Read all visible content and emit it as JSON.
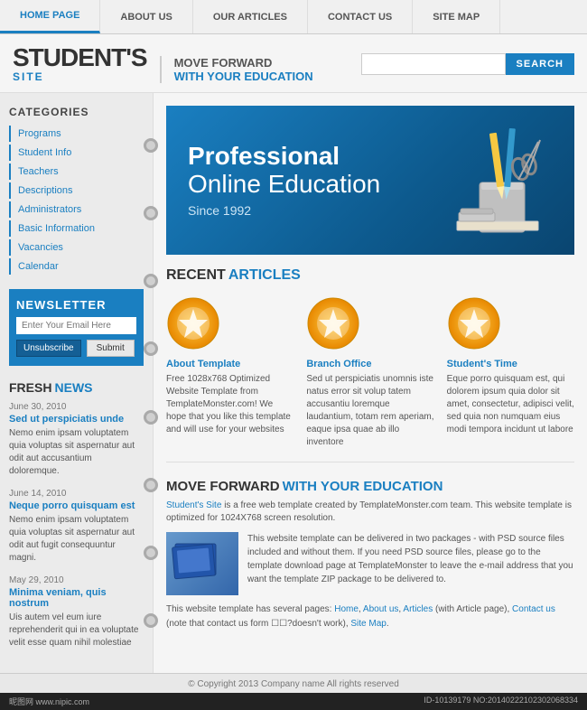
{
  "nav": {
    "items": [
      {
        "label": "HOME PAGE",
        "active": true
      },
      {
        "label": "ABOUT US",
        "active": false
      },
      {
        "label": "OUR ARTICLES",
        "active": false
      },
      {
        "label": "CONTACT US",
        "active": false
      },
      {
        "label": "SITE MAP",
        "active": false
      }
    ]
  },
  "header": {
    "logo_main": "STUDENT'S",
    "logo_sub": "SITE",
    "tagline1": "MOVE FORWARD",
    "tagline2": "WITH YOUR EDUCATION",
    "search_placeholder": "",
    "search_btn": "SEARCH"
  },
  "sidebar": {
    "categories_title": "CATEGORIES",
    "categories": [
      "Programs",
      "Student Info",
      "Teachers",
      "Descriptions",
      "Administrators",
      "Basic Information",
      "Vacancies",
      "Calendar"
    ],
    "newsletter": {
      "title": "NEWSLETTER",
      "input_placeholder": "Enter Your Email Here",
      "unsub_label": "Unsubscribe",
      "submit_label": "Submit"
    },
    "fresh_news_label1": "FRESH",
    "fresh_news_label2": "NEWS",
    "news": [
      {
        "date": "June 30, 2010",
        "headline": "Sed ut perspiciatis unde",
        "body": "Nemo enim ipsam voluptatem quia voluptas sit aspernatur aut odit aut accusantium doloremque."
      },
      {
        "date": "June 14, 2010",
        "headline": "Neque porro quisquam est",
        "body": "Nemo enim ipsam voluptatem quia voluptas sit aspernatur aut odit aut fugit consequuntur magni."
      },
      {
        "date": "May 29, 2010",
        "headline": "Minima veniam, quis nostrum",
        "body": "Uis autem vel eum iure reprehenderit qui in ea voluptate velit esse quam nihil molestiae"
      }
    ]
  },
  "hero": {
    "line1": "Professional",
    "line2": "Online Education",
    "line3": "Since 1992"
  },
  "recent": {
    "label1": "RECENT",
    "label2": "ARTICLES",
    "articles": [
      {
        "title": "About Template",
        "body": "Free 1028x768 Optimized Website Template from TemplateMonster.com! We hope that you like this template and will use for your websites"
      },
      {
        "title": "Branch Office",
        "body": "Sed ut perspiciatis unomnis iste natus error sit volup tatem accusantiu loremque laudantium, totam rem aperiam, eaque ipsa quae ab illo inventore"
      },
      {
        "title": "Student's Time",
        "body": "Eque porro quisquam est, qui dolorem ipsum quia dolor sit amet, consectetur, adipisci velit, sed quia non numquam eius modi tempora incidunt ut labore"
      }
    ]
  },
  "moveforward": {
    "label1": "MOVE FORWARD",
    "label2": "WITH YOUR EDUCATION",
    "intro": "Student's Site is a free web template created by TemplateMonster.com team. This website template is optimized for 1024X768 screen resolution.",
    "body": "This website template can be delivered in two packages - with PSD source files included and without them. If you need PSD source files, please go to the template download page at TemplateMonster to leave the e-mail address that you want the template ZIP package to be delivered to.",
    "footer": "This website template has several pages: Home, About us, Articles (with Article page), Contact us (note that contact us form doesn't work), Site Map.",
    "footer_links": [
      "Home",
      "About us",
      "Articles",
      "Contact us",
      "Site Map"
    ]
  },
  "bottom": {
    "copyright": "© Copyright 2013 Company name All rights reserved",
    "id_info": "ID-10139179 NO:201402221023020683​34"
  }
}
